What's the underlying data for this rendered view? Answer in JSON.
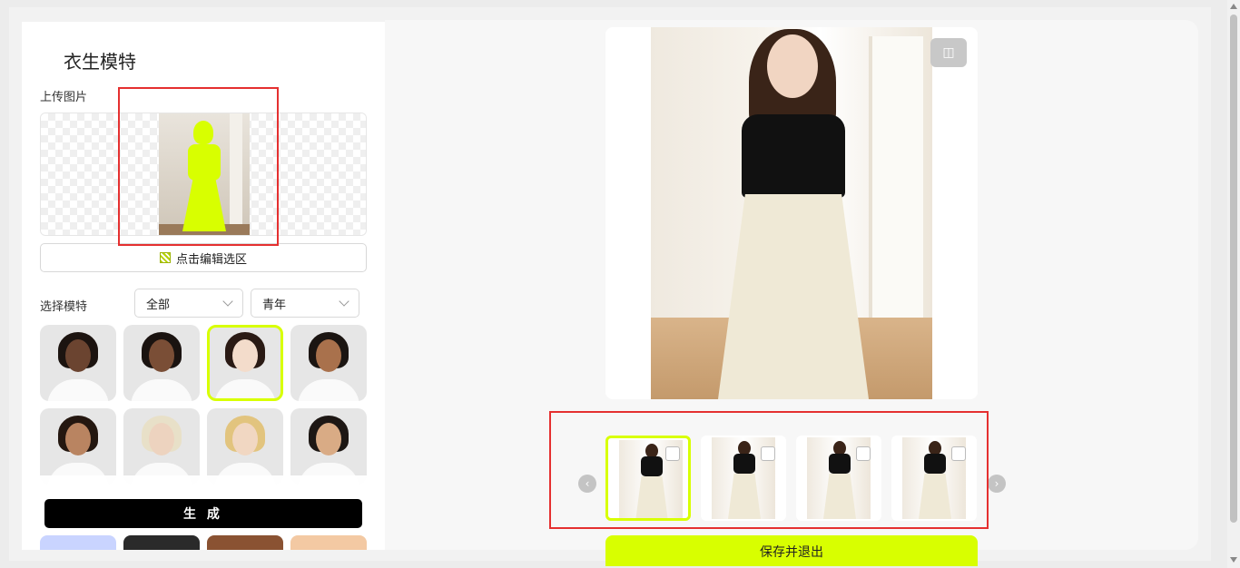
{
  "panel": {
    "title": "衣生模特",
    "upload_label": "上传图片",
    "edit_selection_label": "点击编辑选区",
    "select_model_label": "选择模特",
    "filter_category": "全部",
    "filter_age": "青年",
    "generate_label": "生 成"
  },
  "models": [
    {
      "name": "model-1",
      "skin": "#6b4430",
      "hair": "#1c1410",
      "selected": false
    },
    {
      "name": "model-2",
      "skin": "#7a4e36",
      "hair": "#1a1310",
      "selected": false
    },
    {
      "name": "model-3",
      "skin": "#f3dccb",
      "hair": "#2a1a14",
      "selected": true
    },
    {
      "name": "model-4",
      "skin": "#a9714c",
      "hair": "#1b1512",
      "selected": false
    },
    {
      "name": "model-5",
      "skin": "#b98461",
      "hair": "#241710",
      "selected": false
    },
    {
      "name": "model-6",
      "skin": "#edd3bf",
      "hair": "#e8e0c8",
      "selected": false
    },
    {
      "name": "model-7",
      "skin": "#f1d7c2",
      "hair": "#e2c47e",
      "selected": false
    },
    {
      "name": "model-8",
      "skin": "#d9ab85",
      "hair": "#1d1714",
      "selected": false
    }
  ],
  "swatch_colors": [
    "#c9d4ff",
    "#2a2a2a",
    "#8a5232",
    "#f3c9a3"
  ],
  "result": {
    "compare_icon": "compare-icon",
    "save_label": "保存并退出",
    "thumbnails": [
      {
        "name": "result-1",
        "selected": true
      },
      {
        "name": "result-2",
        "selected": false
      },
      {
        "name": "result-3",
        "selected": false
      },
      {
        "name": "result-4",
        "selected": false
      }
    ],
    "prev_arrow": "‹",
    "next_arrow": "›"
  },
  "colors": {
    "accent": "#d8ff00",
    "highlight_box": "#e53030",
    "button_dark": "#000000"
  }
}
